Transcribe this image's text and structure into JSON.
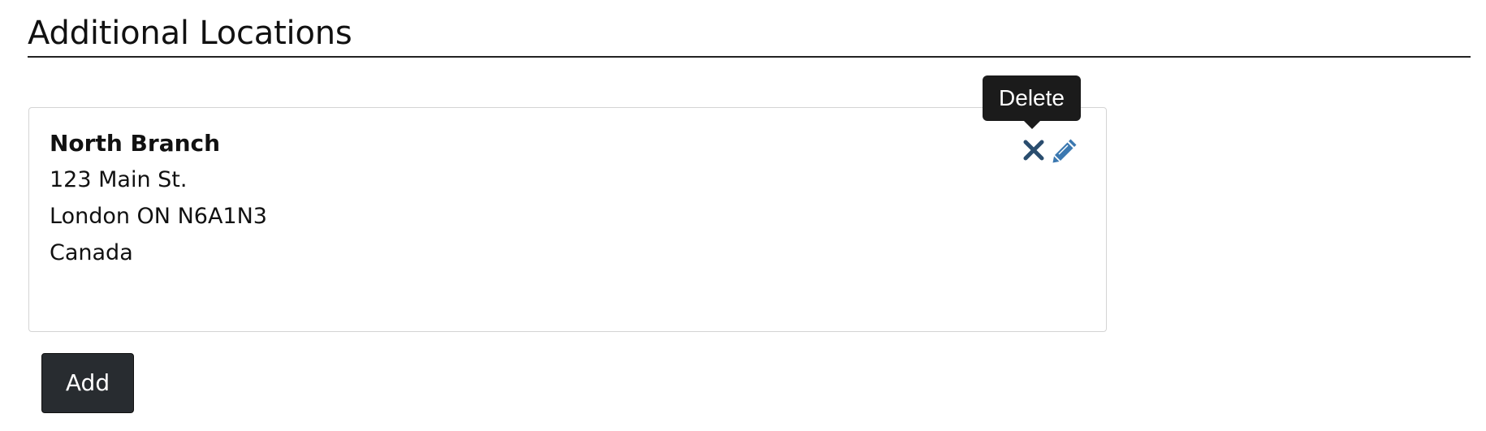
{
  "section": {
    "title": "Additional Locations"
  },
  "location": {
    "name": "North Branch",
    "address_line1": "123 Main St.",
    "address_line2": "London ON N6A1N3",
    "address_line3": "Canada",
    "actions": {
      "delete_icon": "close-x-icon",
      "edit_icon": "pencil-icon"
    }
  },
  "tooltip": {
    "text": "Delete"
  },
  "buttons": {
    "add_label": "Add"
  },
  "colors": {
    "icon_delete": "#2a4d6e",
    "icon_edit": "#3b78b0",
    "tooltip_bg": "#1b1b1b",
    "button_bg": "#282c30",
    "card_border": "#d4d4d4"
  }
}
